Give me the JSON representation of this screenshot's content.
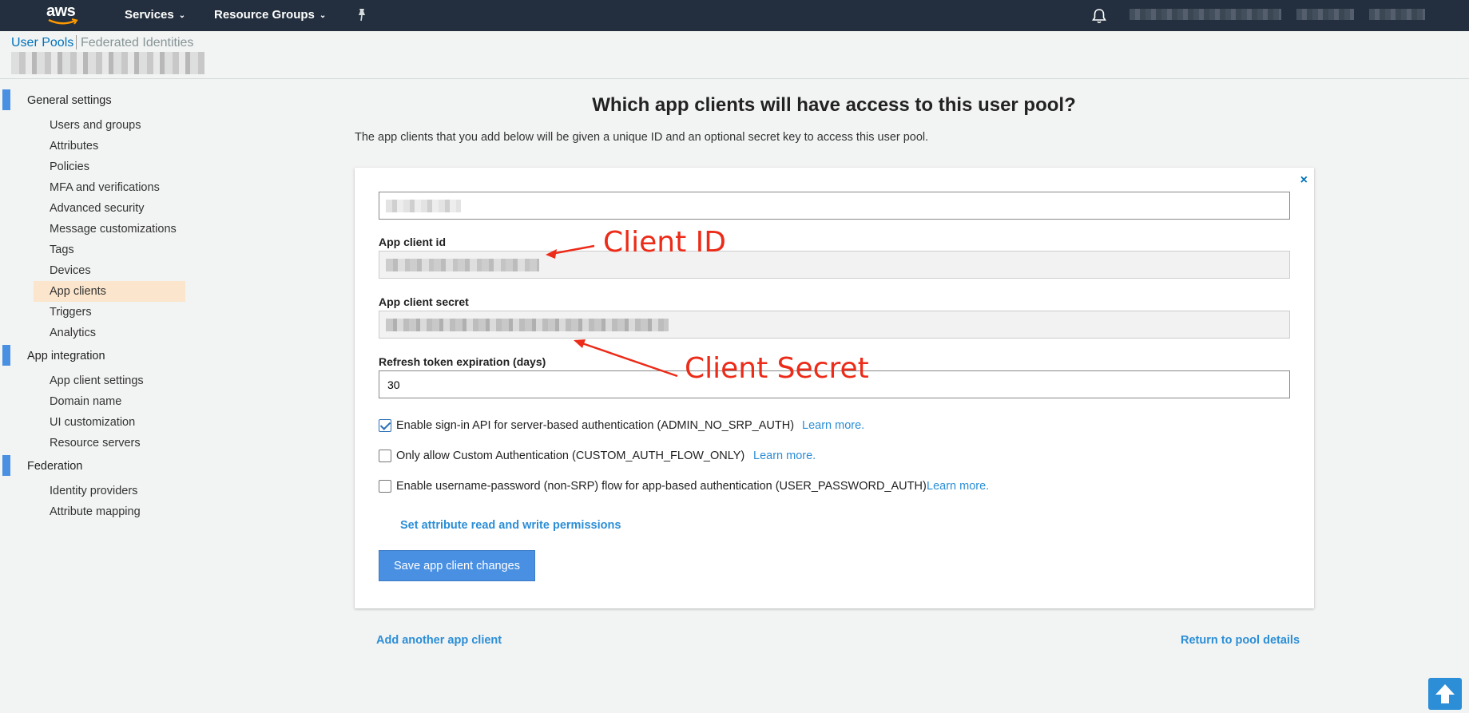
{
  "topnav": {
    "logo_text": "aws",
    "services_label": "Services",
    "resource_groups_label": "Resource Groups"
  },
  "subheader": {
    "user_pools_label": "User Pools",
    "federated_identities_label": "Federated Identities"
  },
  "sidebar": {
    "sections": [
      {
        "label": "General settings",
        "items": [
          "Users and groups",
          "Attributes",
          "Policies",
          "MFA and verifications",
          "Advanced security",
          "Message customizations",
          "Tags",
          "Devices",
          "App clients",
          "Triggers",
          "Analytics"
        ]
      },
      {
        "label": "App integration",
        "items": [
          "App client settings",
          "Domain name",
          "UI customization",
          "Resource servers"
        ]
      },
      {
        "label": "Federation",
        "items": [
          "Identity providers",
          "Attribute mapping"
        ]
      }
    ],
    "active_item": "App clients"
  },
  "main": {
    "title": "Which app clients will have access to this user pool?",
    "description": "The app clients that you add below will be given a unique ID and an optional secret key to access this user pool."
  },
  "card": {
    "close_glyph": "×",
    "client_id_label": "App client id",
    "client_secret_label": "App client secret",
    "refresh_label": "Refresh token expiration (days)",
    "refresh_value": "30",
    "options": [
      {
        "label": "Enable sign-in API for server-based authentication (ADMIN_NO_SRP_AUTH)",
        "checked": true,
        "learn": "Learn more."
      },
      {
        "label": "Only allow Custom Authentication (CUSTOM_AUTH_FLOW_ONLY)",
        "checked": false,
        "learn": "Learn more."
      },
      {
        "label": "Enable username-password (non-SRP) flow for app-based authentication (USER_PASSWORD_AUTH)",
        "checked": false,
        "learn": "Learn more."
      }
    ],
    "permissions_link": "Set attribute read and write permissions",
    "save_button": "Save app client changes"
  },
  "footer_links": {
    "add_client": "Add another app client",
    "return": "Return to pool details"
  },
  "annotations": {
    "client_id": "Client ID",
    "client_secret": "Client Secret"
  },
  "colors": {
    "nav_bg": "#232f3e",
    "link_blue": "#2b8ed6",
    "annotation_red": "#ec2b18",
    "active_item_bg": "#fbe5cc"
  }
}
